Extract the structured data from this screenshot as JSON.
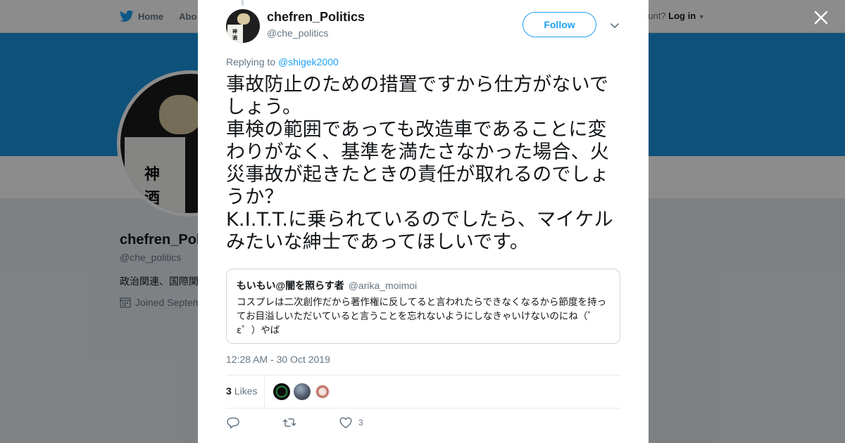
{
  "topbar": {
    "home_label": "Home",
    "about_label": "Abo",
    "account_prompt": "ccount?",
    "login_label": "Log in"
  },
  "profile": {
    "name": "chefren_Pol",
    "handle": "@che_politics",
    "bio": "政治関連、国際関",
    "joined": "Joined Septem",
    "avatar_text_1": "神",
    "avatar_text_2": "酒"
  },
  "tweet": {
    "author_name": "chefren_Politics",
    "author_handle": "@che_politics",
    "follow_label": "Follow",
    "replying_prefix": "Replying to",
    "replying_to": "@shigek2000",
    "text": "事故防止のための措置ですから仕方がないでしょう。\n車検の範囲であっても改造車であることに変わりがなく、基準を満たさなかった場合、火災事故が起きたときの責任が取れるのでしょうか？\nK.I.T.T.に乗られているのでしたら、マイケルみたいな紳士であってほしいです。",
    "quote": {
      "name": "もいもい@闇を照らす者",
      "handle": "@arika_moimoi",
      "text": "コスプレは二次創作だから著作権に反してると言われたらできなくなるから節度を持ってお目溢しいただいていると言うことを忘れないようにしなきゃいけないのにね（゜ε゜）やば"
    },
    "timestamp": "12:28 AM - 30 Oct 2019",
    "likes_count": "3",
    "likes_label": "Likes",
    "actions": {
      "reply_count": "",
      "retweet_count": "",
      "like_count": "3"
    }
  },
  "colors": {
    "accent": "#1da1f2",
    "banner": "#1b95e0",
    "muted": "#657786"
  }
}
